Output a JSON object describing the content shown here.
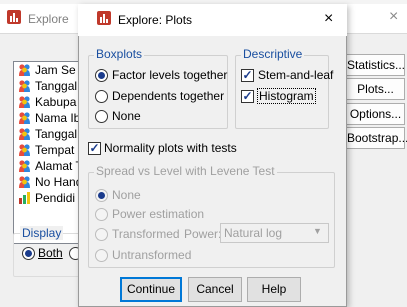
{
  "parent_window": {
    "title": "Explore",
    "close_glyph": "×",
    "variables": [
      {
        "label": "Jam Se",
        "type": "nominal"
      },
      {
        "label": "Tanggal",
        "type": "nominal"
      },
      {
        "label": "Kabupa",
        "type": "nominal"
      },
      {
        "label": "Nama Ib",
        "type": "nominal"
      },
      {
        "label": "Tanggal",
        "type": "nominal"
      },
      {
        "label": "Tempat",
        "type": "nominal"
      },
      {
        "label": "Alamat T",
        "type": "nominal"
      },
      {
        "label": "No Hand",
        "type": "nominal"
      },
      {
        "label": "Pendidi",
        "type": "scale"
      }
    ],
    "display_group": {
      "legend": "Display",
      "both_label": "Both",
      "other_label": "C"
    },
    "side_buttons": {
      "statistics": "Statistics...",
      "plots": "Plots...",
      "options": "Options...",
      "bootstrap": "Bootstrap..."
    }
  },
  "dialog": {
    "title": "Explore: Plots",
    "close_glyph": "×",
    "boxplots": {
      "legend": "Boxplots",
      "options": [
        {
          "label": "Factor levels together",
          "checked": true
        },
        {
          "label": "Dependents together",
          "checked": false
        },
        {
          "label": "None",
          "checked": false
        }
      ]
    },
    "descriptive": {
      "legend": "Descriptive",
      "stem_and_leaf": "Stem-and-leaf",
      "histogram": "Histogram",
      "check_glyph": "✓"
    },
    "normality": {
      "label": "Normality plots with tests",
      "checked": true
    },
    "spread_vs_level": {
      "legend": "Spread vs Level with Levene Test",
      "options": [
        {
          "label": "None",
          "checked": true
        },
        {
          "label": "Power estimation",
          "checked": false
        },
        {
          "label": "Transformed",
          "checked": false
        },
        {
          "label": "Untransformed",
          "checked": false
        }
      ],
      "power_label": "Power:",
      "power_value": "Natural log",
      "arrow_glyph": "▼"
    },
    "buttons": {
      "continue": "Continue",
      "cancel": "Cancel",
      "help": "Help"
    }
  },
  "colors": {
    "accent": "#0078d7",
    "legend_text": "#1a4fa0",
    "disabled_text": "#a0a0a0"
  }
}
